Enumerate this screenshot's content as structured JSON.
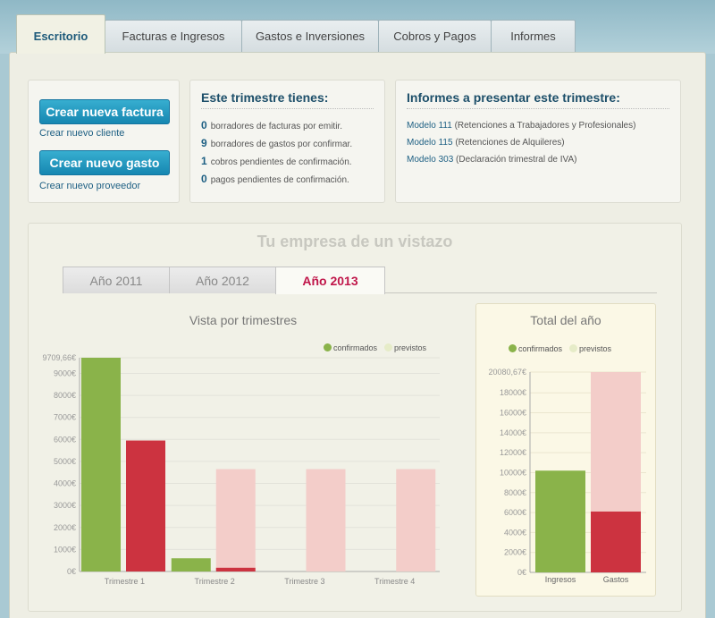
{
  "tabs": [
    "Escritorio",
    "Facturas e Ingresos",
    "Gastos e Inversiones",
    "Cobros y Pagos",
    "Informes"
  ],
  "actions": {
    "new_invoice": "Crear nueva factura",
    "new_client": "Crear nuevo cliente",
    "new_expense": "Crear nuevo gasto",
    "new_supplier": "Crear nuevo proveedor"
  },
  "quarter": {
    "title": "Este trimestre tienes:",
    "items": [
      {
        "count": "0",
        "text": "borradores de facturas por emitir."
      },
      {
        "count": "9",
        "text": "borradores de gastos por confirmar."
      },
      {
        "count": "1",
        "text": "cobros pendientes de confirmación."
      },
      {
        "count": "0",
        "text": "pagos pendientes de confirmación."
      }
    ]
  },
  "reports": {
    "title": "Informes a presentar este trimestre:",
    "items": [
      {
        "model": "Modelo 111",
        "desc": "(Retenciones a Trabajadores y Profesionales)"
      },
      {
        "model": "Modelo 115",
        "desc": "(Retenciones de Alquileres)"
      },
      {
        "model": "Modelo 303",
        "desc": "(Declaración trimestral de IVA)"
      }
    ]
  },
  "overview": {
    "title": "Tu empresa de un vistazo",
    "year_tabs": [
      "Año 2011",
      "Año 2012",
      "Año 2013"
    ],
    "active_year": "Año 2013"
  },
  "colors": {
    "confirmed_income": "#8ab34a",
    "confirmed_expense": "#cc3340",
    "forecast_income": "#e6ecc8",
    "forecast_expense": "#f3cdc9"
  },
  "chart_data": [
    {
      "type": "bar",
      "title": "Vista por trimestres",
      "legend": [
        "confirmados",
        "previstos"
      ],
      "categories": [
        "Trimestre 1",
        "Trimestre 2",
        "Trimestre 3",
        "Trimestre 4"
      ],
      "yticks": [
        "0€",
        "1000€",
        "2000€",
        "3000€",
        "4000€",
        "5000€",
        "6000€",
        "7000€",
        "8000€",
        "9000€",
        "9709,66€"
      ],
      "ylim": [
        0,
        9709.66
      ],
      "series": [
        {
          "name": "Ingresos",
          "confirmed": [
            9709.66,
            600,
            0,
            0
          ],
          "forecast": [
            0,
            0,
            0,
            0
          ]
        },
        {
          "name": "Gastos",
          "confirmed": [
            5950,
            170,
            0,
            0
          ],
          "forecast": [
            0,
            4650,
            4650,
            4650
          ]
        }
      ]
    },
    {
      "type": "bar",
      "title": "Total del año",
      "legend": [
        "confirmados",
        "previstos"
      ],
      "categories": [
        "Ingresos",
        "Gastos"
      ],
      "yticks": [
        "0€",
        "2000€",
        "4000€",
        "6000€",
        "8000€",
        "10000€",
        "12000€",
        "14000€",
        "16000€",
        "18000€",
        "20080,67€"
      ],
      "ylim": [
        0,
        20080.67
      ],
      "confirmed": [
        10200,
        6100
      ],
      "forecast": [
        0,
        13980.67
      ]
    }
  ]
}
